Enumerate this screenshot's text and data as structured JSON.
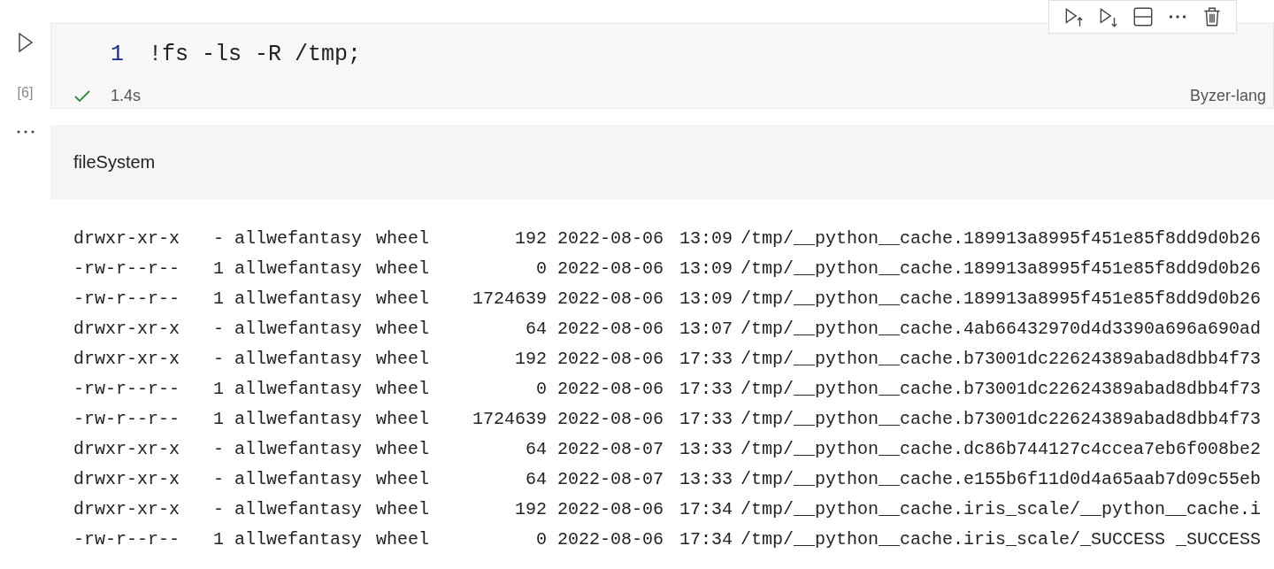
{
  "cell": {
    "execution_count": "[6]",
    "line_number": "1",
    "code": "!fs -ls -R /tmp;",
    "succeeded": true,
    "duration": "1.4s",
    "language": "Byzer-lang"
  },
  "output": {
    "title": "fileSystem",
    "rows": [
      {
        "perm": "drwxr-xr-x",
        "links": "-",
        "owner": "allwefantasy",
        "group": "wheel",
        "size": "192",
        "date": "2022-08-06",
        "time": "13:09",
        "path": "/tmp/__python__cache.189913a8995f451e85f8dd9d0b26"
      },
      {
        "perm": "-rw-r--r--",
        "links": "1",
        "owner": "allwefantasy",
        "group": "wheel",
        "size": "0",
        "date": "2022-08-06",
        "time": "13:09",
        "path": "/tmp/__python__cache.189913a8995f451e85f8dd9d0b26"
      },
      {
        "perm": "-rw-r--r--",
        "links": "1",
        "owner": "allwefantasy",
        "group": "wheel",
        "size": "1724639",
        "date": "2022-08-06",
        "time": "13:09",
        "path": "/tmp/__python__cache.189913a8995f451e85f8dd9d0b26"
      },
      {
        "perm": "drwxr-xr-x",
        "links": "-",
        "owner": "allwefantasy",
        "group": "wheel",
        "size": "64",
        "date": "2022-08-06",
        "time": "13:07",
        "path": "/tmp/__python__cache.4ab66432970d4d3390a696a690ad"
      },
      {
        "perm": "drwxr-xr-x",
        "links": "-",
        "owner": "allwefantasy",
        "group": "wheel",
        "size": "192",
        "date": "2022-08-06",
        "time": "17:33",
        "path": "/tmp/__python__cache.b73001dc22624389abad8dbb4f73"
      },
      {
        "perm": "-rw-r--r--",
        "links": "1",
        "owner": "allwefantasy",
        "group": "wheel",
        "size": "0",
        "date": "2022-08-06",
        "time": "17:33",
        "path": "/tmp/__python__cache.b73001dc22624389abad8dbb4f73"
      },
      {
        "perm": "-rw-r--r--",
        "links": "1",
        "owner": "allwefantasy",
        "group": "wheel",
        "size": "1724639",
        "date": "2022-08-06",
        "time": "17:33",
        "path": "/tmp/__python__cache.b73001dc22624389abad8dbb4f73"
      },
      {
        "perm": "drwxr-xr-x",
        "links": "-",
        "owner": "allwefantasy",
        "group": "wheel",
        "size": "64",
        "date": "2022-08-07",
        "time": "13:33",
        "path": "/tmp/__python__cache.dc86b744127c4ccea7eb6f008be2"
      },
      {
        "perm": "drwxr-xr-x",
        "links": "-",
        "owner": "allwefantasy",
        "group": "wheel",
        "size": "64",
        "date": "2022-08-07",
        "time": "13:33",
        "path": "/tmp/__python__cache.e155b6f11d0d4a65aab7d09c55eb"
      },
      {
        "perm": "drwxr-xr-x",
        "links": "-",
        "owner": "allwefantasy",
        "group": "wheel",
        "size": "192",
        "date": "2022-08-06",
        "time": "17:34",
        "path": "/tmp/__python__cache.iris_scale/__python__cache.i"
      },
      {
        "perm": "-rw-r--r--",
        "links": "1",
        "owner": "allwefantasy",
        "group": "wheel",
        "size": "0",
        "date": "2022-08-06",
        "time": "17:34",
        "path": "/tmp/__python__cache.iris_scale/_SUCCESS _SUCCESS"
      }
    ]
  }
}
